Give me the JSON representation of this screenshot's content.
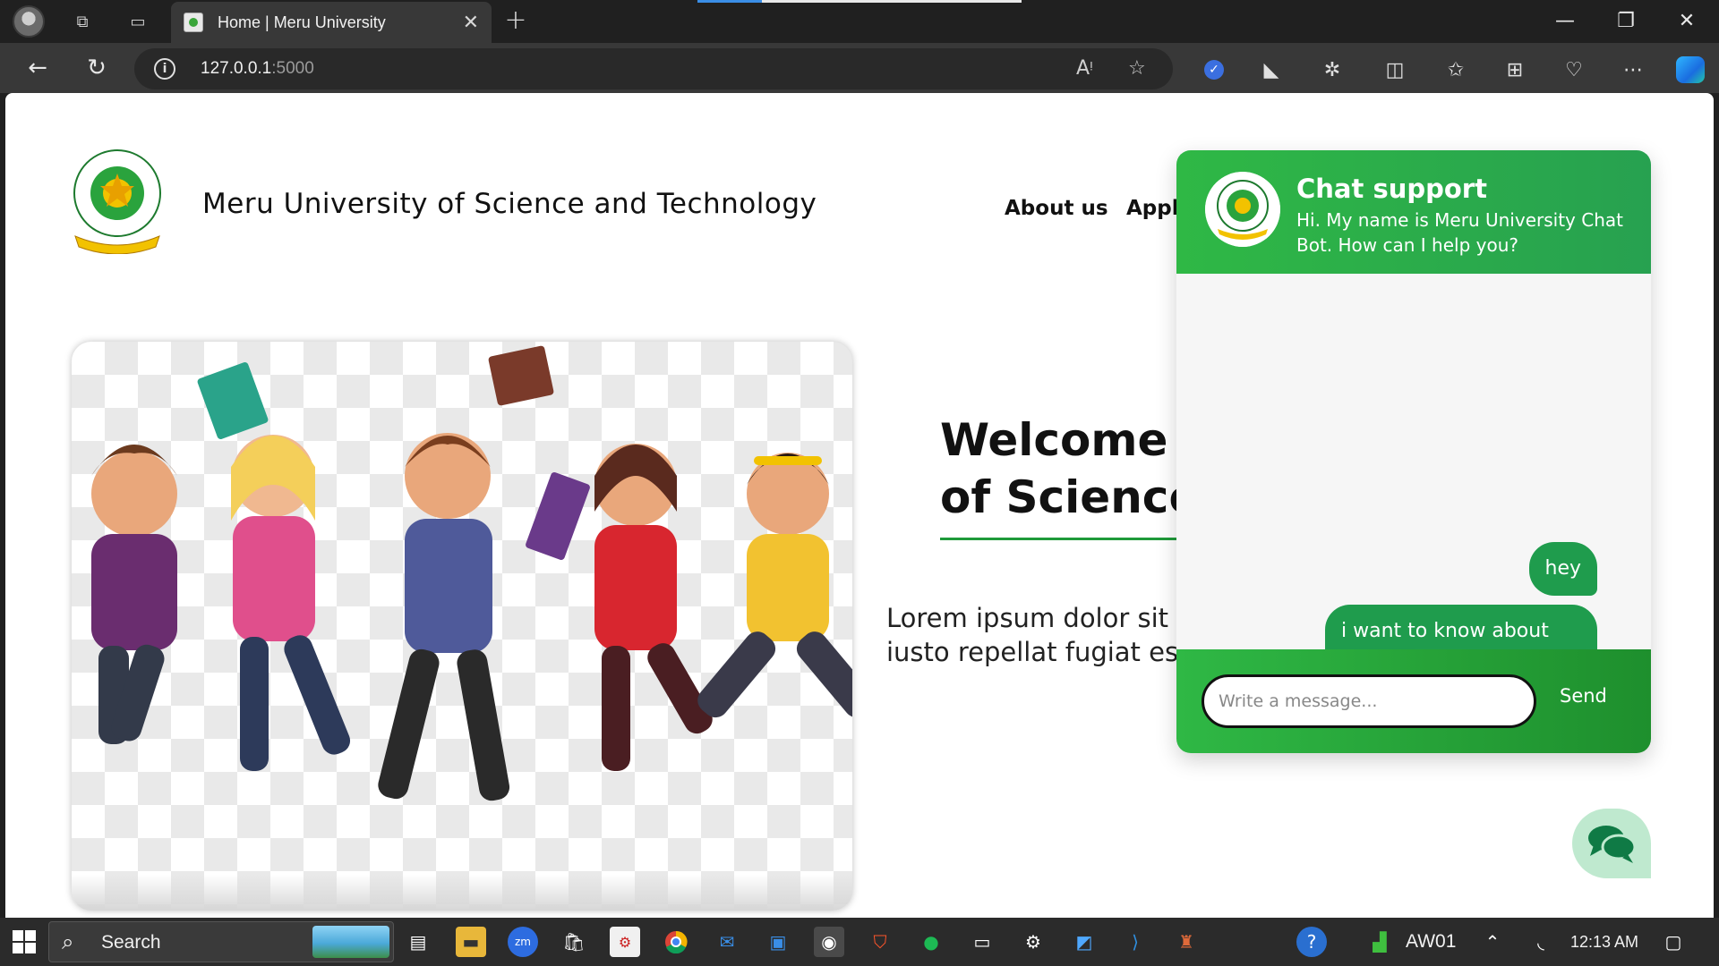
{
  "browser": {
    "tab_title": "Home | Meru University",
    "tab_close": "✕",
    "new_tab": "+",
    "url_host": "127.0.0.1",
    "url_port": ":5000",
    "window_controls": {
      "minimize": "—",
      "maximize": "❐",
      "close": "✕"
    }
  },
  "site": {
    "title": "Meru University of Science and Technology",
    "nav": {
      "about": "About us",
      "apply": "Apply"
    },
    "welcome_line1": "Welcome to",
    "welcome_line2": "of Science a",
    "lorem_line1": "Lorem ipsum dolor sit am",
    "lorem_line2": "iusto repellat fugiat esse v"
  },
  "chat": {
    "title": "Chat support",
    "greeting": "Hi. My name is Meru University Chat Bot. How can I help you?",
    "messages": [
      {
        "text": "hey"
      },
      {
        "text": "i want to know about meru town campus"
      }
    ],
    "input_placeholder": "Write a message...",
    "send_label": "Send"
  },
  "taskbar": {
    "search_label": "Search",
    "network_name": "AW01",
    "time": "12:13 AM"
  },
  "colors": {
    "accent_green": "#2fb845",
    "bubble_green": "#1f9c4d",
    "browser_dark": "#202020"
  }
}
